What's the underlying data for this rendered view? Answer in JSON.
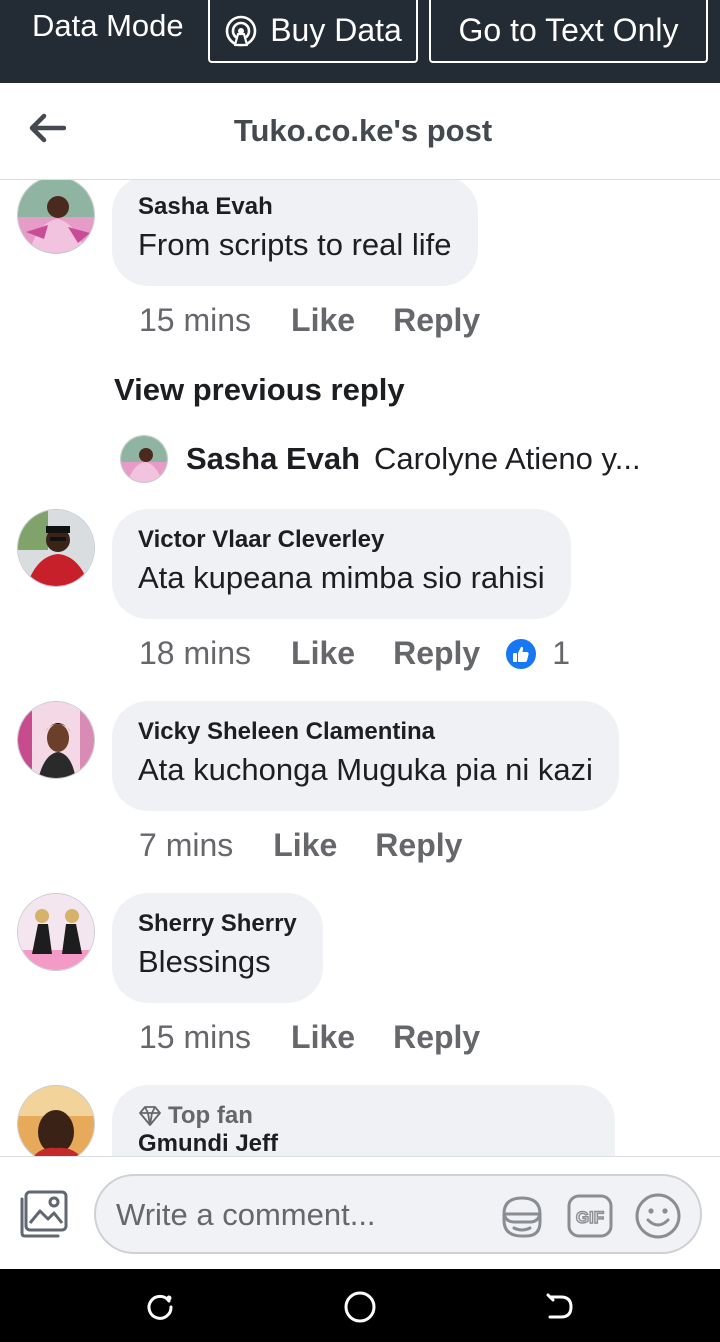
{
  "data_bar": {
    "mode_label": "Data Mode",
    "buy_data_label": "Buy Data",
    "text_only_label": "Go to Text Only"
  },
  "header": {
    "title": "Tuko.co.ke's post"
  },
  "comments": [
    {
      "author": "Sasha Evah",
      "text": "From scripts to real life",
      "time": "15 mins",
      "like_label": "Like",
      "reply_label": "Reply"
    },
    {
      "author": "Victor Vlaar Cleverley",
      "text": "Ata kupeana mimba sio rahisi",
      "time": "18 mins",
      "like_label": "Like",
      "reply_label": "Reply",
      "reactions": "1"
    },
    {
      "author": "Vicky Sheleen Clamentina",
      "text": "Ata kuchonga Muguka pia ni kazi",
      "time": "7 mins",
      "like_label": "Like",
      "reply_label": "Reply"
    },
    {
      "author": "Sherry Sherry",
      "text": "Blessings",
      "time": "15 mins",
      "like_label": "Like",
      "reply_label": "Reply"
    },
    {
      "badge": "Top fan",
      "author": "Gmundi Jeff"
    }
  ],
  "replies": {
    "view_previous_label": "View previous reply",
    "preview_author": "Sasha Evah",
    "preview_text": "Carolyne Atieno y..."
  },
  "composer": {
    "placeholder": "Write a comment...",
    "gif_label": "GIF"
  },
  "colors": {
    "data_bar_bg": "#232b35",
    "bubble_bg": "#eff1f4",
    "like_blue": "#1877f2",
    "secondary_text": "#65676b"
  }
}
